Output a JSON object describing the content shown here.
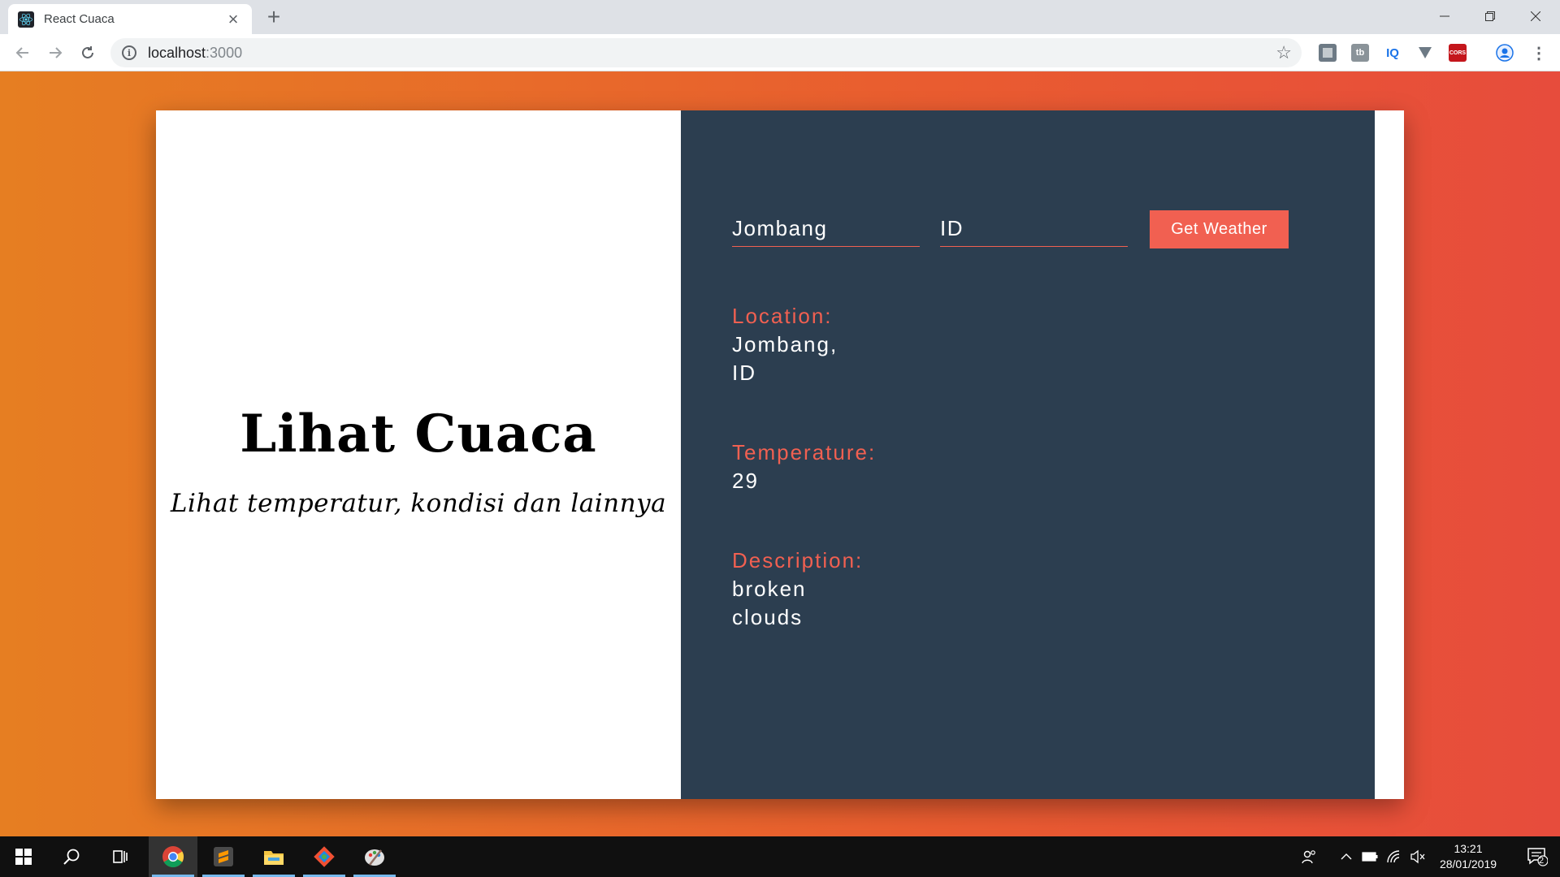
{
  "browser": {
    "tab": {
      "title": "React Cuaca",
      "favicon": "react-logo-icon",
      "close": "close-icon"
    },
    "new_tab": "plus-icon",
    "window_controls": [
      "minimize-icon",
      "restore-icon",
      "close-icon"
    ],
    "toolbar": {
      "back": "back-arrow-icon",
      "forward": "forward-arrow-icon",
      "reload": "reload-icon",
      "address": {
        "host": "localhost",
        "port": ":3000",
        "site_info": "info-icon"
      },
      "bookmark": "star-icon",
      "extensions": [
        {
          "name": "extension-icon-1",
          "label": "",
          "color": "#6d7a85"
        },
        {
          "name": "extension-icon-tb",
          "label": "tb",
          "color": "#8a9399"
        },
        {
          "name": "extension-icon-iq",
          "label": "IQ",
          "color": "#ffffff"
        },
        {
          "name": "extension-icon-v",
          "label": "",
          "color": "#ffffff"
        },
        {
          "name": "extension-icon-cors",
          "label": "CORS",
          "color": "#c4161c"
        }
      ],
      "profile": "profile-icon",
      "menu": "more-vert-icon"
    }
  },
  "app": {
    "title": "Lihat Cuaca",
    "subtitle": "Lihat temperatur, kondisi dan lainnya",
    "form": {
      "city_value": "Jombang",
      "country_value": "ID",
      "button_label": "Get Weather"
    },
    "weather": {
      "location_key": "Location:",
      "location_value": "Jombang, ID",
      "temperature_key": "Temperature:",
      "temperature_value": "29",
      "description_key": "Description:",
      "description_value": "broken clouds"
    },
    "colors": {
      "accent": "#f16051",
      "panel": "#2c3e50",
      "gradient_start": "#e67e22",
      "gradient_end": "#e74c3c"
    }
  },
  "taskbar": {
    "start": "windows-start-icon",
    "search": "search-icon",
    "task_view": "task-view-icon",
    "apps": [
      {
        "name": "chrome-icon",
        "active": true
      },
      {
        "name": "sublime-text-icon",
        "active": false
      },
      {
        "name": "file-explorer-icon",
        "active": false
      },
      {
        "name": "git-icon",
        "active": false
      },
      {
        "name": "paint-icon",
        "active": false
      }
    ],
    "tray": [
      "people-icon",
      "chevron-up-icon",
      "battery-icon",
      "wifi-icon",
      "volume-muted-icon"
    ],
    "time": "13:21",
    "date": "28/01/2019",
    "notifications": "2"
  }
}
